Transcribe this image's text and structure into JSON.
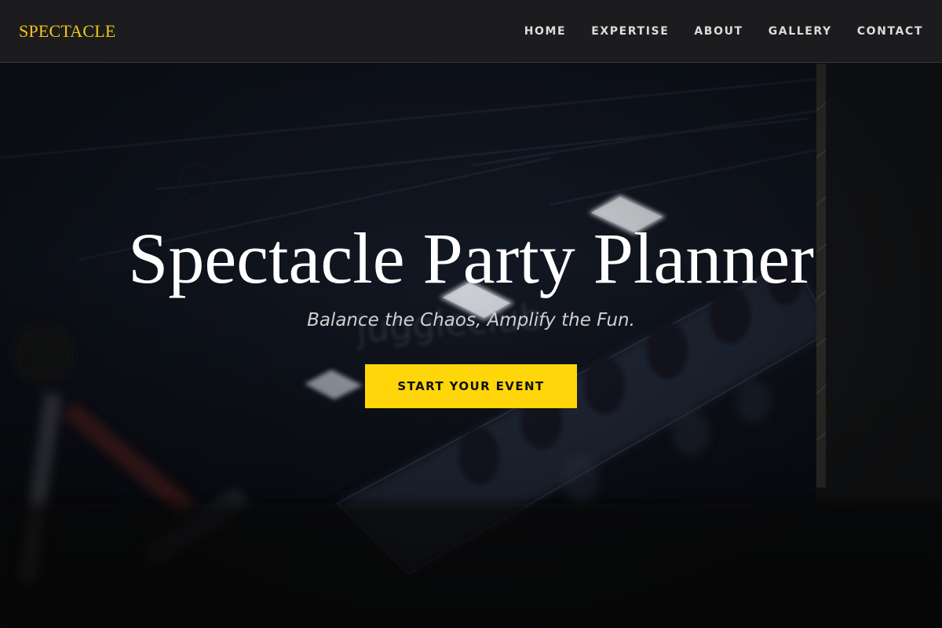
{
  "brand": {
    "name": "SPECTACLE"
  },
  "nav": {
    "items": [
      {
        "label": "HOME"
      },
      {
        "label": "EXPERTISE"
      },
      {
        "label": "ABOUT"
      },
      {
        "label": "GALLERY"
      },
      {
        "label": "CONTACT"
      }
    ]
  },
  "hero": {
    "title": "Spectacle Party Planner",
    "subtitle": "Balance the Chaos, Amplify the Fun.",
    "cta_label": "START YOUR EVENT",
    "background_sign_text": "juggleclub"
  },
  "colors": {
    "accent": "#ffd60a",
    "brand": "#f5c518",
    "navbar_bg": "#1c1c1e",
    "hero_text": "#ffffff"
  }
}
